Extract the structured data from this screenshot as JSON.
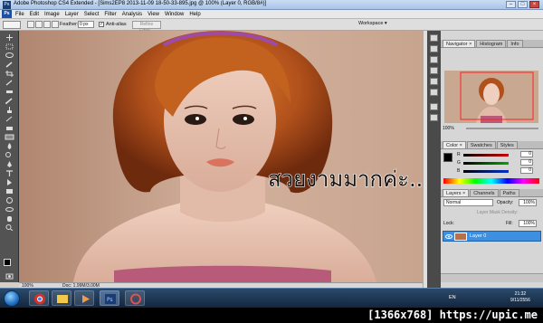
{
  "window": {
    "title": "Adobe Photoshop CS4 Extended - [Sims2EP8 2013-11-09 18-50-33-895.jpg @ 100% (Layer 0, RGB/8#)]",
    "ps_badge": "Ps",
    "buttons": [
      "–",
      "□",
      "×"
    ]
  },
  "menubar": {
    "logo": "Ps",
    "items": [
      "File",
      "Edit",
      "Image",
      "Layer",
      "Select",
      "Filter",
      "Analysis",
      "View",
      "Window",
      "Help"
    ]
  },
  "options": {
    "feather_label": "Feather:",
    "feather_value": "0 px",
    "antialias_label": "Anti-alias",
    "antialias_checked": "✓",
    "refine_edge": "Refine Edge...",
    "workspace": "Workspace ▾"
  },
  "canvas": {
    "overlay_text": "สวยงามมากค่ะ.....",
    "background_color": "#c9a892"
  },
  "statusbar": {
    "zoom": "100%",
    "doc": "Doc: 1.99M/3.00M"
  },
  "navigator": {
    "tabs": [
      "Navigator ×",
      "Histogram",
      "Info"
    ],
    "zoom": "100%",
    "view_box_color": "#ff2020"
  },
  "color": {
    "tabs": [
      "Color ×",
      "Swatches",
      "Styles"
    ],
    "rows": [
      {
        "label": "R",
        "value": "0",
        "bar": "#cc0000"
      },
      {
        "label": "G",
        "value": "0",
        "bar": "#00aa00"
      },
      {
        "label": "B",
        "value": "0",
        "bar": "#0033cc"
      }
    ]
  },
  "layers": {
    "tabs": [
      "Layers ×",
      "Channels",
      "Paths"
    ],
    "blend_mode": "Normal",
    "opacity_label": "Opacity:",
    "opacity_value": "100%",
    "mask_label": "Layer Mask Density:",
    "lock_label": "Lock:",
    "fill_label": "Fill:",
    "fill_value": "100%",
    "layer_name": "Layer 0"
  },
  "taskbar": {
    "language": "EN",
    "time": "21:32",
    "date": "9/11/2556"
  },
  "caption": "[1366x768] https://upic.me"
}
